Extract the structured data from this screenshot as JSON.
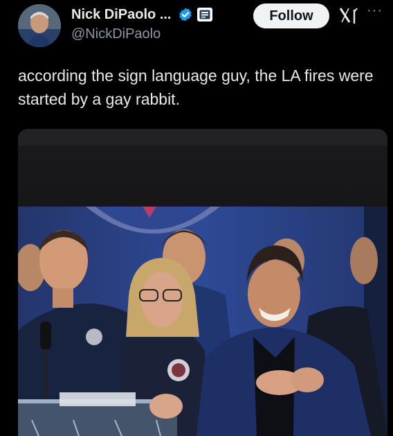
{
  "author": {
    "display_name": "Nick DiPaolo ...",
    "handle": "@NickDiPaolo"
  },
  "follow_label": "Follow",
  "tweet": {
    "text": "according the sign language guy, the LA fires were started by a gay rabbit."
  },
  "icons": {
    "verified": "verified-badge-icon",
    "affiliation": "affiliation-badge-icon",
    "x_logo": "x-logo-icon",
    "more": "more-options-icon"
  },
  "colors": {
    "background": "#000000",
    "verified_blue": "#1d9bf0",
    "follow_bg": "#eff3f4",
    "secondary_text": "#8b98a5"
  }
}
